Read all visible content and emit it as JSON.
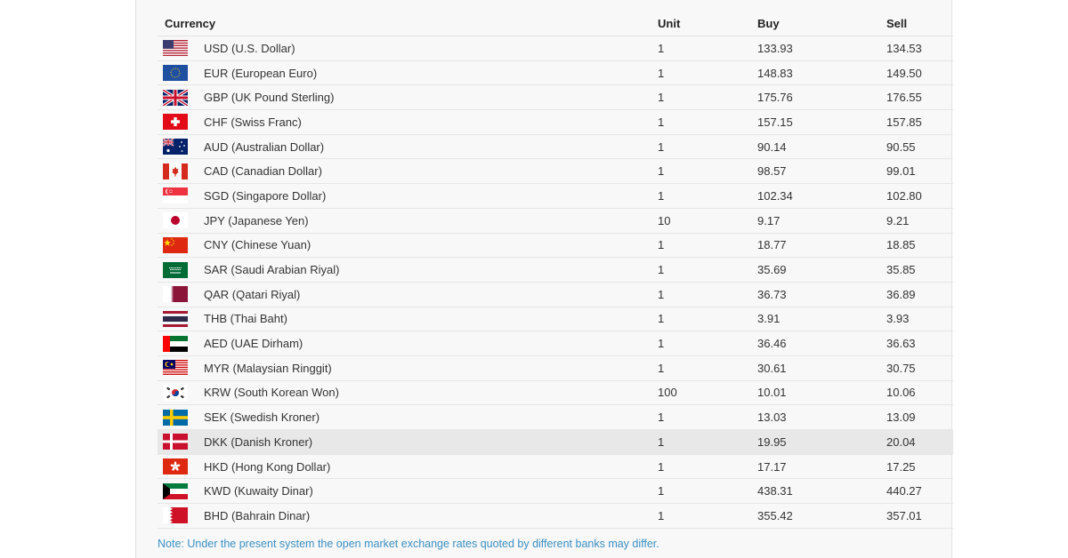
{
  "table": {
    "headers": {
      "currency": "Currency",
      "unit": "Unit",
      "buy": "Buy",
      "sell": "Sell"
    },
    "rows": [
      {
        "flag": "us-flag-icon",
        "currency": "USD (U.S. Dollar)",
        "unit": "1",
        "buy": "133.93",
        "sell": "134.53"
      },
      {
        "flag": "eu-flag-icon",
        "currency": "EUR (European Euro)",
        "unit": "1",
        "buy": "148.83",
        "sell": "149.50"
      },
      {
        "flag": "uk-flag-icon",
        "currency": "GBP (UK Pound Sterling)",
        "unit": "1",
        "buy": "175.76",
        "sell": "176.55"
      },
      {
        "flag": "ch-flag-icon",
        "currency": "CHF (Swiss Franc)",
        "unit": "1",
        "buy": "157.15",
        "sell": "157.85"
      },
      {
        "flag": "au-flag-icon",
        "currency": "AUD (Australian Dollar)",
        "unit": "1",
        "buy": "90.14",
        "sell": "90.55"
      },
      {
        "flag": "ca-flag-icon",
        "currency": "CAD (Canadian Dollar)",
        "unit": "1",
        "buy": "98.57",
        "sell": "99.01"
      },
      {
        "flag": "sg-flag-icon",
        "currency": "SGD (Singapore Dollar)",
        "unit": "1",
        "buy": "102.34",
        "sell": "102.80"
      },
      {
        "flag": "jp-flag-icon",
        "currency": "JPY (Japanese Yen)",
        "unit": "10",
        "buy": "9.17",
        "sell": "9.21"
      },
      {
        "flag": "cn-flag-icon",
        "currency": "CNY (Chinese Yuan)",
        "unit": "1",
        "buy": "18.77",
        "sell": "18.85"
      },
      {
        "flag": "sa-flag-icon",
        "currency": "SAR (Saudi Arabian Riyal)",
        "unit": "1",
        "buy": "35.69",
        "sell": "35.85"
      },
      {
        "flag": "qa-flag-icon",
        "currency": "QAR (Qatari Riyal)",
        "unit": "1",
        "buy": "36.73",
        "sell": "36.89"
      },
      {
        "flag": "th-flag-icon",
        "currency": "THB (Thai Baht)",
        "unit": "1",
        "buy": "3.91",
        "sell": "3.93"
      },
      {
        "flag": "ae-flag-icon",
        "currency": "AED (UAE Dirham)",
        "unit": "1",
        "buy": "36.46",
        "sell": "36.63"
      },
      {
        "flag": "my-flag-icon",
        "currency": "MYR (Malaysian Ringgit)",
        "unit": "1",
        "buy": "30.61",
        "sell": "30.75"
      },
      {
        "flag": "kr-flag-icon",
        "currency": "KRW (South Korean Won)",
        "unit": "100",
        "buy": "10.01",
        "sell": "10.06"
      },
      {
        "flag": "se-flag-icon",
        "currency": "SEK (Swedish Kroner)",
        "unit": "1",
        "buy": "13.03",
        "sell": "13.09"
      },
      {
        "flag": "dk-flag-icon",
        "currency": "DKK (Danish Kroner)",
        "unit": "1",
        "buy": "19.95",
        "sell": "20.04",
        "highlighted": true
      },
      {
        "flag": "hk-flag-icon",
        "currency": "HKD (Hong Kong Dollar)",
        "unit": "1",
        "buy": "17.17",
        "sell": "17.25"
      },
      {
        "flag": "kw-flag-icon",
        "currency": "KWD (Kuwaity Dinar)",
        "unit": "1",
        "buy": "438.31",
        "sell": "440.27"
      },
      {
        "flag": "bh-flag-icon",
        "currency": "BHD (Bahrain Dinar)",
        "unit": "1",
        "buy": "355.42",
        "sell": "357.01"
      }
    ]
  },
  "note": "Note: Under the present system the open market exchange rates quoted by different banks may differ.",
  "colors": {
    "note": "#3a8fc4",
    "highlight_row": "#e8e8e8",
    "panel": "#f8f8f8"
  }
}
